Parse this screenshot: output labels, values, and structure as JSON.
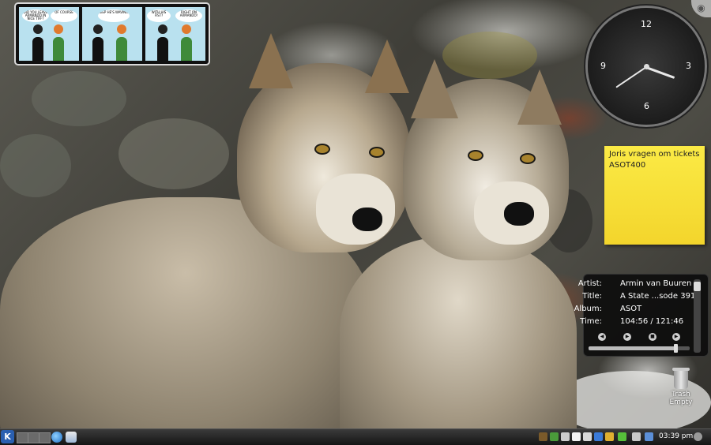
{
  "comic": {
    "bubbles": [
      "DID YOU LEAVE ARMANDO IN NICE TIFF?",
      "OF COURSE",
      "BEEP HE'S WAVING!",
      "WITH HIS FIST?",
      "RIGHT ON ARMANDO!"
    ]
  },
  "clock": {
    "numerals": {
      "twelve": "12",
      "three": "3",
      "six": "6",
      "nine": "9"
    }
  },
  "note": {
    "line1": "Joris vragen om tickets",
    "line2": "ASOT400"
  },
  "player": {
    "artist_label": "Artist:",
    "artist": "Armin van Buuren",
    "title_label": "Title:",
    "title": "A State ...sode 391",
    "album_label": "Album:",
    "album": "ASOT",
    "time_label": "Time:",
    "time": "104:56 / 121:46",
    "progress_fraction": 0.862,
    "controls": [
      "previous",
      "play",
      "stop",
      "next"
    ]
  },
  "trash": {
    "label": "Trash",
    "status": "Empty"
  },
  "taskbar": {
    "clock_text": "03:39 pm",
    "kmenu_label": "K"
  },
  "colors": {
    "note_yellow": "#f7e03a",
    "taskbar": "#1f1f1f",
    "kmenu_blue": "#2a5fb0"
  }
}
